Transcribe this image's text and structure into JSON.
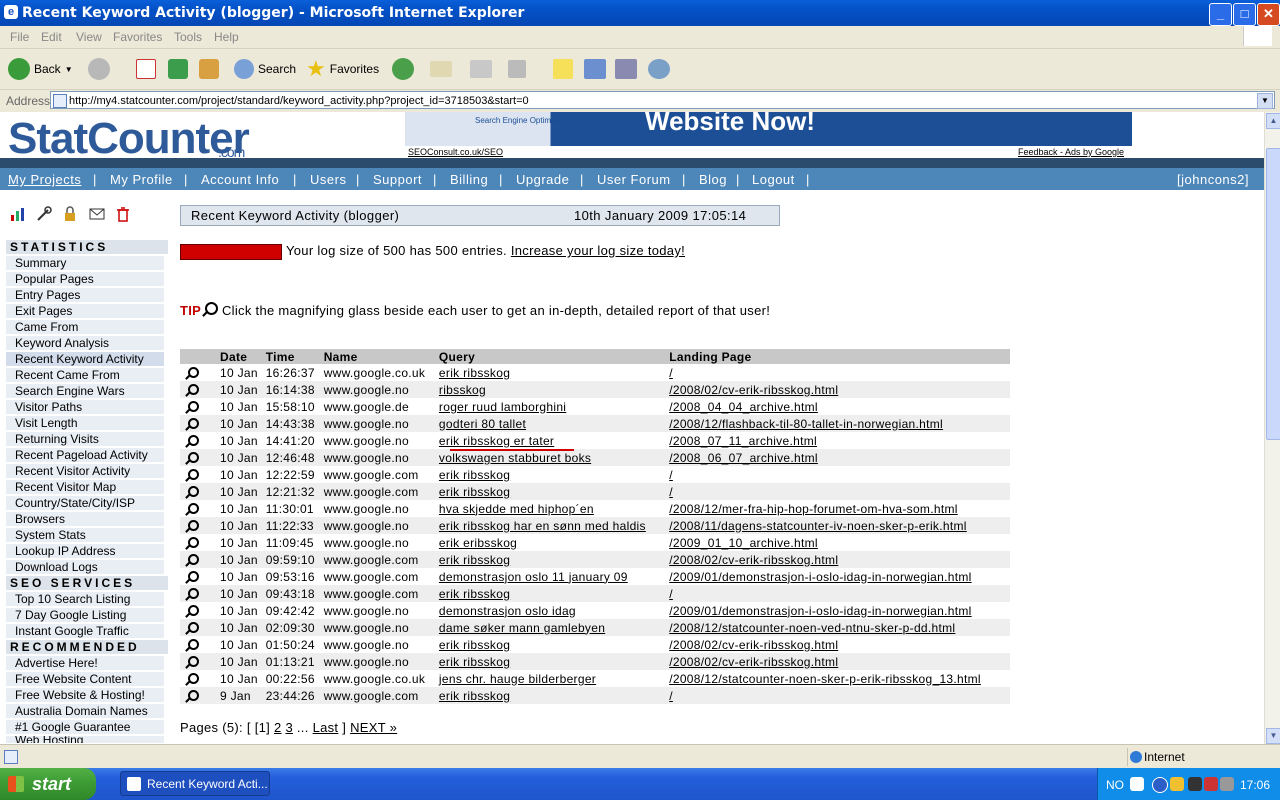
{
  "window": {
    "title": "Recent Keyword Activity (blogger) - Microsoft Internet Explorer",
    "minimize": "_",
    "maximize": "□",
    "close": "✕"
  },
  "menu": [
    "File",
    "Edit",
    "View",
    "Favorites",
    "Tools",
    "Help"
  ],
  "toolbar": {
    "back": "Back",
    "search": "Search",
    "favorites": "Favorites"
  },
  "address": {
    "label": "Address",
    "url": "http://my4.statcounter.com/project/standard/keyword_activity.php?project_id=3718503&start=0"
  },
  "header": {
    "logo": "StatCounter",
    "logo_suffix": ".com",
    "banner_text": "Website Now!",
    "banner_small": "Search Engine Optimisation",
    "ad_link_left": "SEOConsult.co.uk/SEO",
    "ad_link_right": "Feedback - Ads by Google"
  },
  "nav": {
    "items": [
      "My Projects",
      "My Profile",
      "Account Info",
      "Users",
      "Support",
      "Billing",
      "Upgrade",
      "User Forum",
      "Blog",
      "Logout"
    ],
    "user": "[johncons2]"
  },
  "sidebar": {
    "statistics_heading": "STATISTICS",
    "statistics": [
      "Summary",
      "Popular Pages",
      "Entry Pages",
      "Exit Pages",
      "Came From",
      "Keyword Analysis",
      "Recent Keyword Activity",
      "Recent Came From",
      "Search Engine Wars",
      "Visitor Paths",
      "Visit Length",
      "Returning Visits",
      "Recent Pageload Activity",
      "Recent Visitor Activity",
      "Recent Visitor Map",
      "Country/State/City/ISP",
      "Browsers",
      "System Stats",
      "Lookup IP Address",
      "Download Logs"
    ],
    "seo_heading": "SEO SERVICES",
    "seo": [
      "Top 10 Search Listing",
      "7 Day Google Listing",
      "Instant Google Traffic"
    ],
    "rec_heading": "RECOMMENDED",
    "recommended": [
      "Advertise Here!",
      "Free Website Content",
      "Free Website & Hosting!",
      "Australia Domain Names",
      "#1 Google Guarantee",
      "Web Hosting"
    ]
  },
  "main": {
    "heading": "Recent Keyword Activity (blogger)",
    "datetime": "10th January 2009 17:05:14",
    "log_text": "Your log size of 500 has 500 entries.",
    "log_link": "Increase your log size today!",
    "tip_label": "TIP",
    "tip_text": "Click the magnifying glass beside each user to get an in-depth, detailed report of that user!",
    "columns": [
      "Date",
      "Time",
      "Name",
      "Query",
      "Landing Page"
    ],
    "rows": [
      [
        "10 Jan",
        "16:26:37",
        "www.google.co.uk",
        "erik ribsskog",
        "/"
      ],
      [
        "10 Jan",
        "16:14:38",
        "www.google.no",
        "ribsskog",
        "/2008/02/cv-erik-ribsskog.html"
      ],
      [
        "10 Jan",
        "15:58:10",
        "www.google.de",
        "roger ruud lamborghini",
        "/2008_04_04_archive.html"
      ],
      [
        "10 Jan",
        "14:43:38",
        "www.google.no",
        "godteri 80 tallet",
        "/2008/12/flashback-til-80-tallet-in-norwegian.html"
      ],
      [
        "10 Jan",
        "14:41:20",
        "www.google.no",
        "erik ribsskog er tater",
        "/2008_07_11_archive.html"
      ],
      [
        "10 Jan",
        "12:46:48",
        "www.google.no",
        "volkswagen stabburet boks",
        "/2008_06_07_archive.html"
      ],
      [
        "10 Jan",
        "12:22:59",
        "www.google.com",
        "erik ribsskog",
        "/"
      ],
      [
        "10 Jan",
        "12:21:32",
        "www.google.com",
        "erik ribsskog",
        "/"
      ],
      [
        "10 Jan",
        "11:30:01",
        "www.google.no",
        "hva skjedde med hiphop´en",
        "/2008/12/mer-fra-hip-hop-forumet-om-hva-som.html"
      ],
      [
        "10 Jan",
        "11:22:33",
        "www.google.no",
        "erik ribsskog har en sønn med haldis",
        "/2008/11/dagens-statcounter-iv-noen-sker-p-erik.html"
      ],
      [
        "10 Jan",
        "11:09:45",
        "www.google.no",
        "erik eribsskog",
        "/2009_01_10_archive.html"
      ],
      [
        "10 Jan",
        "09:59:10",
        "www.google.com",
        "erik ribsskog",
        "/2008/02/cv-erik-ribsskog.html"
      ],
      [
        "10 Jan",
        "09:53:16",
        "www.google.com",
        "demonstrasjon oslo 11 january 09",
        "/2009/01/demonstrasjon-i-oslo-idag-in-norwegian.html"
      ],
      [
        "10 Jan",
        "09:43:18",
        "www.google.com",
        "erik ribsskog",
        "/"
      ],
      [
        "10 Jan",
        "09:42:42",
        "www.google.no",
        "demonstrasjon oslo idag",
        "/2009/01/demonstrasjon-i-oslo-idag-in-norwegian.html"
      ],
      [
        "10 Jan",
        "02:09:30",
        "www.google.no",
        "dame søker mann gamlebyen",
        "/2008/12/statcounter-noen-ved-ntnu-sker-p-dd.html"
      ],
      [
        "10 Jan",
        "01:50:24",
        "www.google.no",
        "erik ribsskog",
        "/2008/02/cv-erik-ribsskog.html"
      ],
      [
        "10 Jan",
        "01:13:21",
        "www.google.no",
        "erik ribsskog",
        "/2008/02/cv-erik-ribsskog.html"
      ],
      [
        "10 Jan",
        "00:22:56",
        "www.google.co.uk",
        "jens chr. hauge bilderberger",
        "/2008/12/statcounter-noen-sker-p-erik-ribsskog_13.html"
      ],
      [
        "9 Jan",
        "23:44:26",
        "www.google.com",
        "erik ribsskog",
        "/"
      ]
    ],
    "pages_prefix": "Pages (5): [ [1]",
    "pages": [
      "2",
      "3"
    ],
    "pages_ellipsis": "...",
    "last": "Last",
    "pages_bracket": "]",
    "next": "NEXT »"
  },
  "status": {
    "zone": "Internet"
  },
  "taskbar": {
    "start": "start",
    "task": "Recent Keyword Acti...",
    "lang": "NO",
    "clock": "17:06"
  }
}
